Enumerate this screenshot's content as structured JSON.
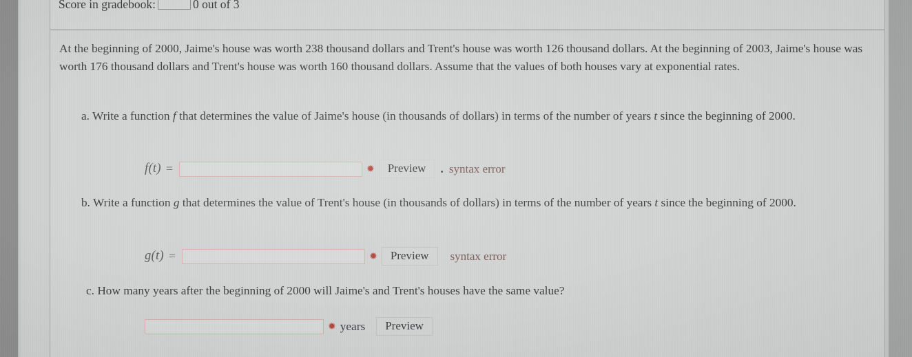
{
  "score": {
    "label": "Score in gradebook:",
    "value": "0 out of 3"
  },
  "problem": {
    "intro": "At the beginning of 2000, Jaime's house was worth 238 thousand dollars and Trent's house was worth 126 thousand dollars. At the beginning of 2003, Jaime's house was worth 176 thousand dollars and Trent's house was worth 160 thousand dollars. Assume that the values of both houses vary at exponential rates."
  },
  "parts": [
    {
      "letter": "a.",
      "text_1": "Write a function ",
      "var_1": "f",
      "text_2": " that determines the value of Jaime's house (in thousands of dollars) in terms of the number of years ",
      "var_2": "t",
      "text_3": " since the beginning of 2000.",
      "function_label": "f(t)",
      "equals": "=",
      "input_value": "",
      "input_placeholder": "",
      "required_marker": "✹",
      "preview_label": "Preview",
      "separator": ".",
      "error_text": "syntax error"
    },
    {
      "letter": "b.",
      "text_1": "Write a function ",
      "var_1": "g",
      "text_2": " that determines the value of Trent's house (in thousands of dollars) in terms of the number of years ",
      "var_2": "t",
      "text_3": " since the beginning of 2000.",
      "function_label": "g(t)",
      "equals": "=",
      "input_value": "",
      "input_placeholder": "",
      "required_marker": "✹",
      "preview_label": "Preview",
      "separator": "",
      "error_text": "syntax error"
    },
    {
      "letter": "c.",
      "text_1": "How many years after the beginning of 2000 will Jaime's and Trent's houses have the same value?",
      "input_value": "",
      "input_placeholder": "",
      "required_marker": "✹",
      "unit_label": "years",
      "preview_label": "Preview"
    }
  ],
  "colors": {
    "page_background": "#d2d4d4",
    "text": "#3e4042",
    "error": "#7b5b55",
    "required_marker": "#b5473c",
    "input_border": "#dcb2ab",
    "button_border": "#c2c4c4"
  }
}
